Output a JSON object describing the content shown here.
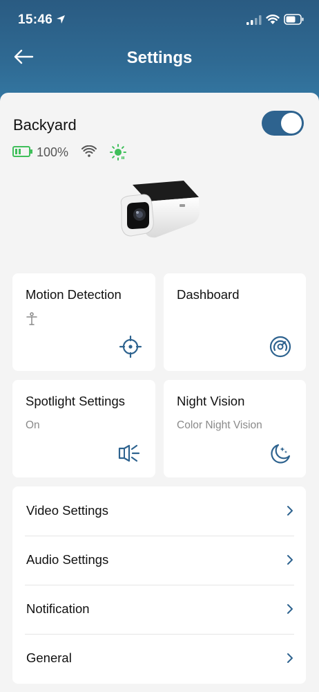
{
  "status_bar": {
    "time": "15:46"
  },
  "header": {
    "title": "Settings"
  },
  "device": {
    "name": "Backyard",
    "battery": "100%",
    "enabled": true
  },
  "cards": {
    "motion": {
      "title": "Motion Detection"
    },
    "dashboard": {
      "title": "Dashboard"
    },
    "spotlight": {
      "title": "Spotlight Settings",
      "value": "On"
    },
    "night_vision": {
      "title": "Night Vision",
      "value": "Color Night Vision"
    }
  },
  "menu": [
    {
      "label": "Video Settings"
    },
    {
      "label": "Audio Settings"
    },
    {
      "label": "Notification"
    },
    {
      "label": "General"
    }
  ],
  "colors": {
    "header": "#2f6a93",
    "accent": "#2e638f",
    "green": "#3fbf5a"
  }
}
